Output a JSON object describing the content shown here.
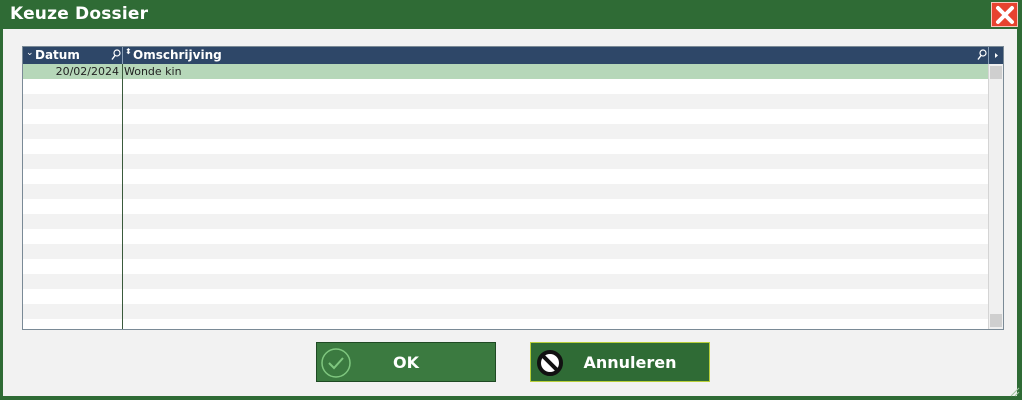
{
  "window": {
    "title": "Keuze Dossier"
  },
  "grid": {
    "columns": [
      {
        "label": "Datum"
      },
      {
        "label": "Omschrijving"
      }
    ],
    "rows": [
      {
        "datum": "20/02/2024",
        "omschrijving": "Wonde kin",
        "selected": true
      }
    ]
  },
  "buttons": {
    "ok_label": "OK",
    "cancel_label": "Annuleren"
  },
  "colors": {
    "frame": "#2f6b35",
    "header": "#2e4768",
    "selected_row": "#b6d7b9",
    "close": "#e8432f"
  },
  "icons": [
    "close-icon",
    "sort-icon",
    "search-icon",
    "check-icon",
    "cancel-icon"
  ]
}
